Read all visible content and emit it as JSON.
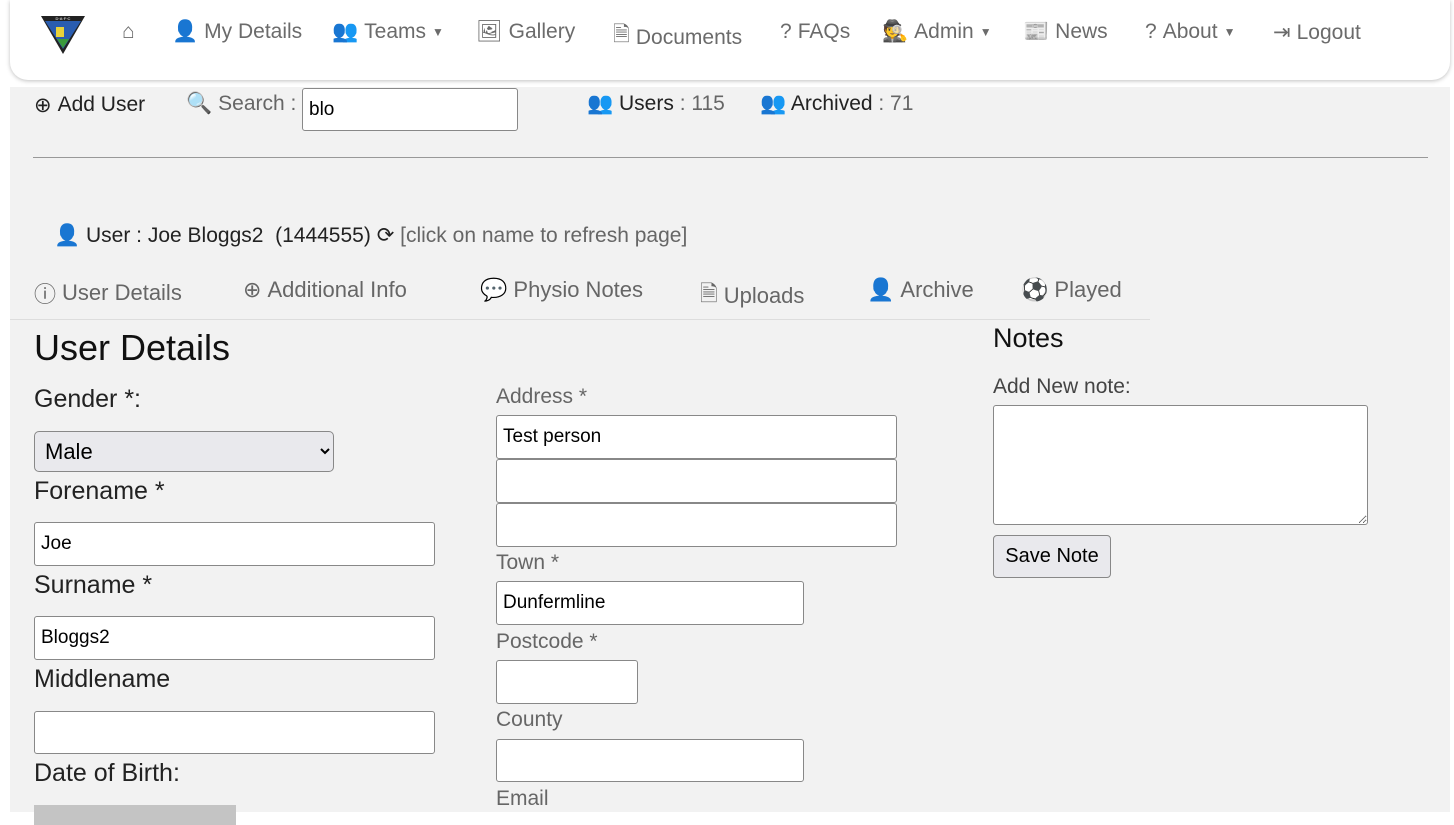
{
  "nav": {
    "logo_text": "DAFC",
    "items": [
      {
        "label": "",
        "icon": "home-icon"
      },
      {
        "label": "My Details",
        "icon": "user-icon"
      },
      {
        "label": "Teams",
        "icon": "users-icon",
        "dropdown": true
      },
      {
        "label": "Gallery",
        "icon": "image-icon"
      },
      {
        "label": "Documents",
        "icon": "file-icon"
      },
      {
        "label": "FAQs",
        "icon": "question-icon"
      },
      {
        "label": "Admin",
        "icon": "user-secret-icon",
        "dropdown": true
      },
      {
        "label": "News",
        "icon": "newspaper-icon"
      },
      {
        "label": "About",
        "icon": "question-icon",
        "dropdown": true
      },
      {
        "label": "Logout",
        "icon": "sign-out-icon"
      }
    ]
  },
  "toolbar": {
    "add_user": "Add User",
    "search_label": "Search :",
    "search_value": "blo",
    "users_label": "Users",
    "users_count": ": 115",
    "archived_label": "Archived",
    "archived_count": ": 71"
  },
  "user": {
    "label": "User : Joe Bloggs2  (1444555)",
    "refresh_hint": "[click on name to refresh page]"
  },
  "tabs": [
    "User Details",
    "Additional Info",
    "Physio Notes",
    "Uploads",
    "Archive",
    "Played"
  ],
  "form": {
    "title": "User Details",
    "gender_label": "Gender *:",
    "gender_value": "Male",
    "forename_label": "Forename *",
    "forename": "Joe",
    "surname_label": "Surname *",
    "surname": "Bloggs2",
    "middlename_label": "Middlename",
    "middlename": "",
    "dob_label": "Date of Birth:",
    "address_label": "Address *",
    "address1": "Test person",
    "address2": "",
    "address3": "",
    "town_label": "Town *",
    "town": "Dunfermline",
    "postcode_label": "Postcode *",
    "postcode": "",
    "county_label": "County",
    "county": "",
    "email_label": "Email"
  },
  "notes": {
    "title": "Notes",
    "add_label": "Add New note:",
    "value": "",
    "save": "Save Note"
  }
}
